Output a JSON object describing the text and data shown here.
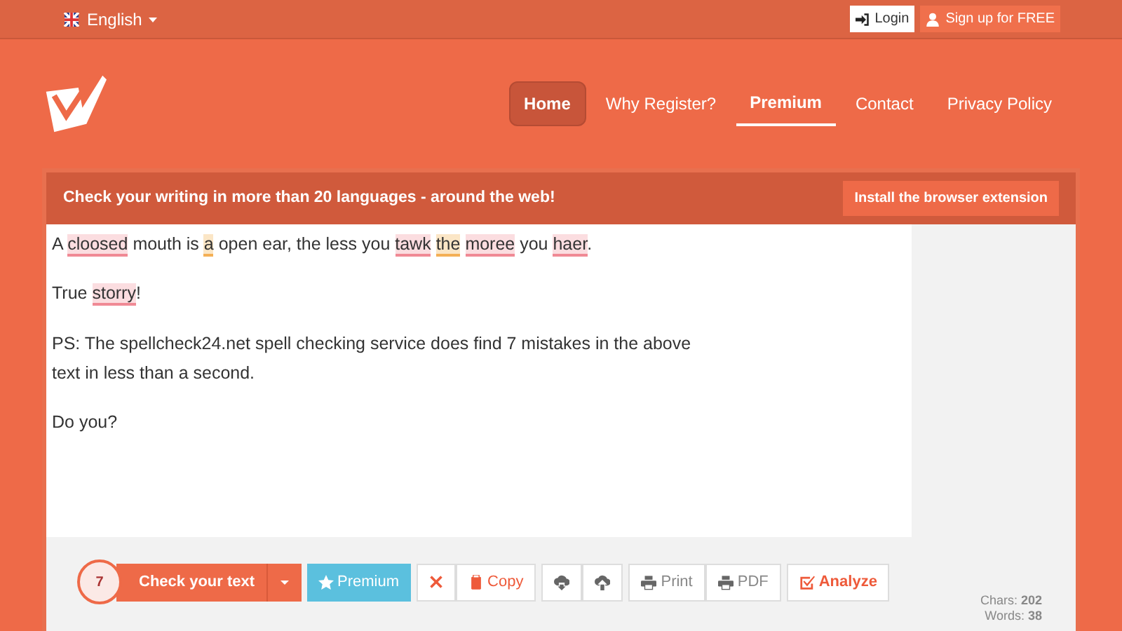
{
  "top_bar": {
    "language": "English",
    "login": "Login",
    "signup": "Sign up for FREE"
  },
  "nav": [
    {
      "label": "Home",
      "selected": true,
      "underlined": false
    },
    {
      "label": "Why Register?",
      "selected": false,
      "underlined": false
    },
    {
      "label": "Premium",
      "selected": false,
      "underlined": true
    },
    {
      "label": "Contact",
      "selected": false,
      "underlined": false
    },
    {
      "label": "Privacy Policy",
      "selected": false,
      "underlined": false
    }
  ],
  "banner": {
    "text": "Check your writing in more than 20 languages - around the web!",
    "button": "Install the browser extension"
  },
  "editor": {
    "paragraphs": [
      [
        {
          "text": "A ",
          "kind": "plain"
        },
        {
          "text": "cloosed",
          "kind": "spelling"
        },
        {
          "text": " mouth is ",
          "kind": "plain"
        },
        {
          "text": "a",
          "kind": "grammar"
        },
        {
          "text": " open ear, the less you ",
          "kind": "plain"
        },
        {
          "text": "tawk",
          "kind": "spelling",
          "space_after": true
        },
        {
          "text": "the",
          "kind": "grammar",
          "space_after": true
        },
        {
          "text": "moree",
          "kind": "spelling"
        },
        {
          "text": " you ",
          "kind": "plain"
        },
        {
          "text": "haer",
          "kind": "spelling"
        },
        {
          "text": ".",
          "kind": "plain"
        }
      ],
      [
        {
          "text": "True ",
          "kind": "plain"
        },
        {
          "text": "storry",
          "kind": "spelling"
        },
        {
          "text": "!",
          "kind": "plain"
        }
      ],
      [
        {
          "text": "PS: The spellcheck24.net spell checking service does find 7 mistakes in the above text in less than a second.",
          "kind": "plain"
        }
      ],
      [
        {
          "text": "Do you?",
          "kind": "plain"
        }
      ]
    ]
  },
  "toolbar": {
    "mistakes": "7",
    "check": "Check your text",
    "premium": "Premium",
    "copy": "Copy",
    "print": "Print",
    "pdf": "PDF",
    "analyze": "Analyze"
  },
  "stats": [
    "Chars: **202**",
    "Words: **38**"
  ]
}
